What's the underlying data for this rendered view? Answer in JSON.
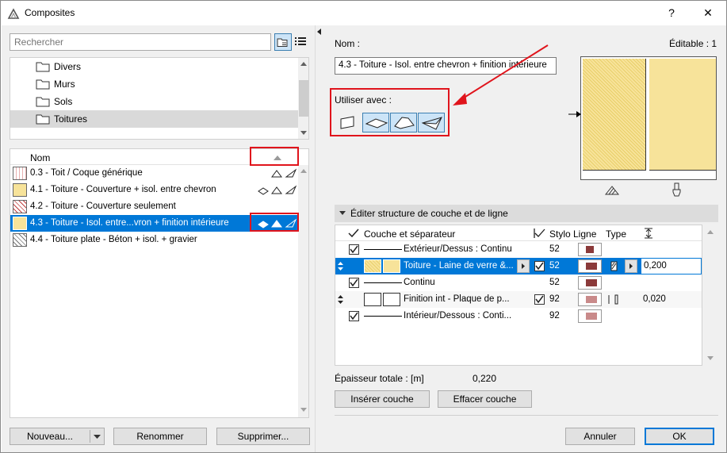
{
  "window": {
    "title": "Composites",
    "help_label": "?",
    "close_label": "✕"
  },
  "search": {
    "placeholder": "Rechercher"
  },
  "folders": [
    {
      "label": "Divers"
    },
    {
      "label": "Murs"
    },
    {
      "label": "Sols"
    },
    {
      "label": "Toitures"
    }
  ],
  "composites_list": {
    "header_name": "Nom",
    "rows": [
      {
        "label": "0.3 - Toit / Coque générique"
      },
      {
        "label": "4.1 - Toiture - Couverture + isol. entre chevron"
      },
      {
        "label": "4.2 - Toiture - Couverture seulement"
      },
      {
        "label": "4.3 - Toiture - Isol. entre...vron + finition intérieure"
      },
      {
        "label": "4.4 - Toiture plate - Béton + isol. + gravier"
      }
    ]
  },
  "left_buttons": {
    "new": "Nouveau...",
    "rename": "Renommer",
    "delete": "Supprimer..."
  },
  "details": {
    "name_label": "Nom :",
    "editable": "Éditable : 1",
    "name_value": "4.3 - Toiture - Isol. entre chevron + finition intérieure",
    "use_with_label": "Utiliser avec :"
  },
  "structure": {
    "section_title": "Éditer structure de couche et de ligne",
    "columns": {
      "layer": "Couche et séparateur",
      "pen": "Stylo Ligne",
      "type": "Type"
    },
    "rows": [
      {
        "name": "Extérieur/Dessus : Continu",
        "pen": "52",
        "thickness": ""
      },
      {
        "name": "Toiture - Laine de verre &...",
        "pen": "52",
        "thickness": "0,200"
      },
      {
        "name": "Continu",
        "pen": "52",
        "thickness": ""
      },
      {
        "name": "Finition int - Plaque de p...",
        "pen": "92",
        "thickness": "0,020"
      },
      {
        "name": "Intérieur/Dessous : Conti...",
        "pen": "92",
        "thickness": ""
      }
    ],
    "total_label": "Épaisseur totale : [m]",
    "total_value": "0,220",
    "insert_button": "Insérer couche",
    "delete_button": "Effacer couche"
  },
  "dialog_buttons": {
    "cancel": "Annuler",
    "ok": "OK"
  },
  "colors": {
    "accent": "#0078d7",
    "annotation_red": "#e0141c",
    "insulation_yellow": "#f7e39a"
  }
}
